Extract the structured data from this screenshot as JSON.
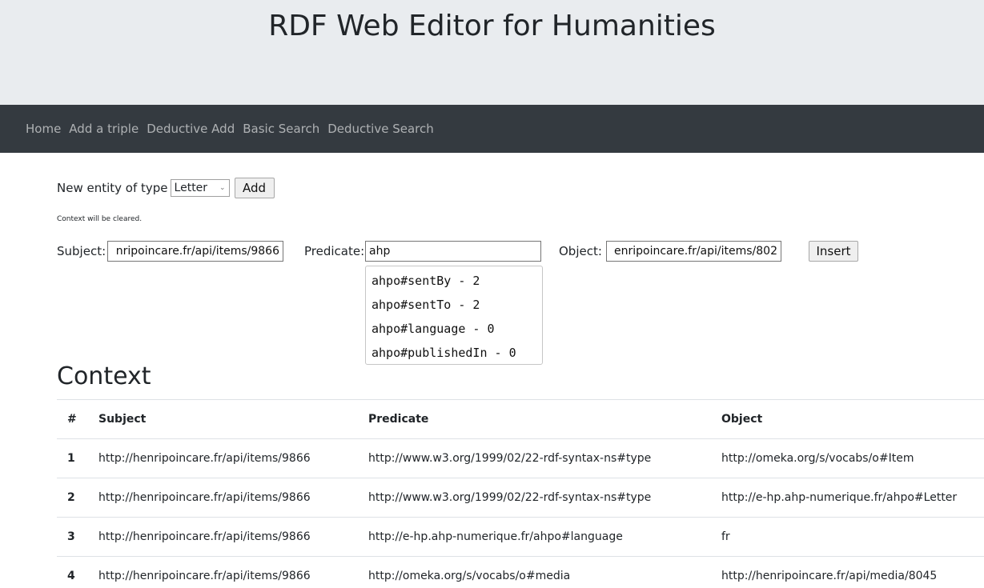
{
  "header": {
    "title": "RDF Web Editor for Humanities"
  },
  "nav": {
    "items": [
      "Home",
      "Add a triple",
      "Deductive Add",
      "Basic Search",
      "Deductive Search"
    ]
  },
  "new_entity": {
    "label": "New entity of type",
    "selected_type": "Letter",
    "add_label": "Add",
    "note": "Context will be cleared."
  },
  "triple_form": {
    "subject_label": "Subject:",
    "subject_value": "nripoincare.fr/api/items/9866",
    "predicate_label": "Predicate:",
    "predicate_value": "ahp",
    "object_label": "Object:",
    "object_value": "enripoincare.fr/api/items/802",
    "insert_label": "Insert"
  },
  "autocomplete": {
    "options": [
      "ahpo#sentBy - 2",
      "ahpo#sentTo - 2",
      "ahpo#language - 0",
      "ahpo#publishedIn - 0"
    ]
  },
  "context": {
    "heading": "Context",
    "columns": [
      "#",
      "Subject",
      "Predicate",
      "Object"
    ],
    "rows": [
      [
        "1",
        "http://henripoincare.fr/api/items/9866",
        "http://www.w3.org/1999/02/22-rdf-syntax-ns#type",
        "http://omeka.org/s/vocabs/o#Item"
      ],
      [
        "2",
        "http://henripoincare.fr/api/items/9866",
        "http://www.w3.org/1999/02/22-rdf-syntax-ns#type",
        "http://e-hp.ahp-numerique.fr/ahpo#Letter"
      ],
      [
        "3",
        "http://henripoincare.fr/api/items/9866",
        "http://e-hp.ahp-numerique.fr/ahpo#language",
        "fr"
      ],
      [
        "4",
        "http://henripoincare.fr/api/items/9866",
        "http://omeka.org/s/vocabs/o#media",
        "http://henripoincare.fr/api/media/8045"
      ]
    ]
  },
  "colors": {
    "jumbotron": "#e9ecef",
    "navbar": "#343a40",
    "nav_text": "#a6a8aa"
  }
}
